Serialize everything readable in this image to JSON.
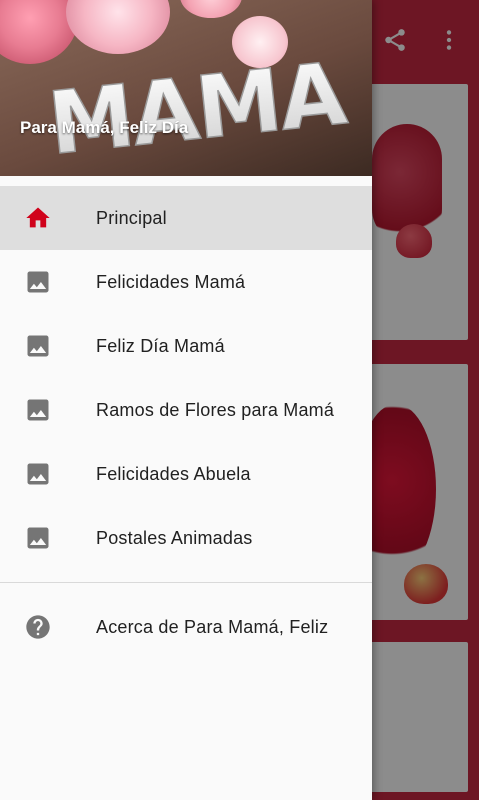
{
  "drawer": {
    "header_title": "Para Mamá, Feliz Día",
    "header_image_text": "MAMA",
    "items": [
      {
        "label": "Principal",
        "icon": "home-icon",
        "selected": true
      },
      {
        "label": "Felicidades Mamá",
        "icon": "image-icon",
        "selected": false
      },
      {
        "label": "Feliz Día Mamá",
        "icon": "image-icon",
        "selected": false
      },
      {
        "label": "Ramos de Flores para Mamá",
        "icon": "image-icon",
        "selected": false
      },
      {
        "label": "Felicidades Abuela",
        "icon": "image-icon",
        "selected": false
      },
      {
        "label": "Postales Animadas",
        "icon": "image-icon",
        "selected": false
      }
    ],
    "secondary_items": [
      {
        "label": "Acerca de Para Mamá, Feliz",
        "icon": "help-icon"
      }
    ]
  },
  "app_bar": {
    "actions": [
      {
        "icon": "share-icon"
      },
      {
        "icon": "more-vert-icon"
      }
    ]
  },
  "colors": {
    "primary": "#c62842",
    "accent": "#d0021b",
    "icon_gray": "#757575",
    "selected_bg": "#dedede"
  }
}
